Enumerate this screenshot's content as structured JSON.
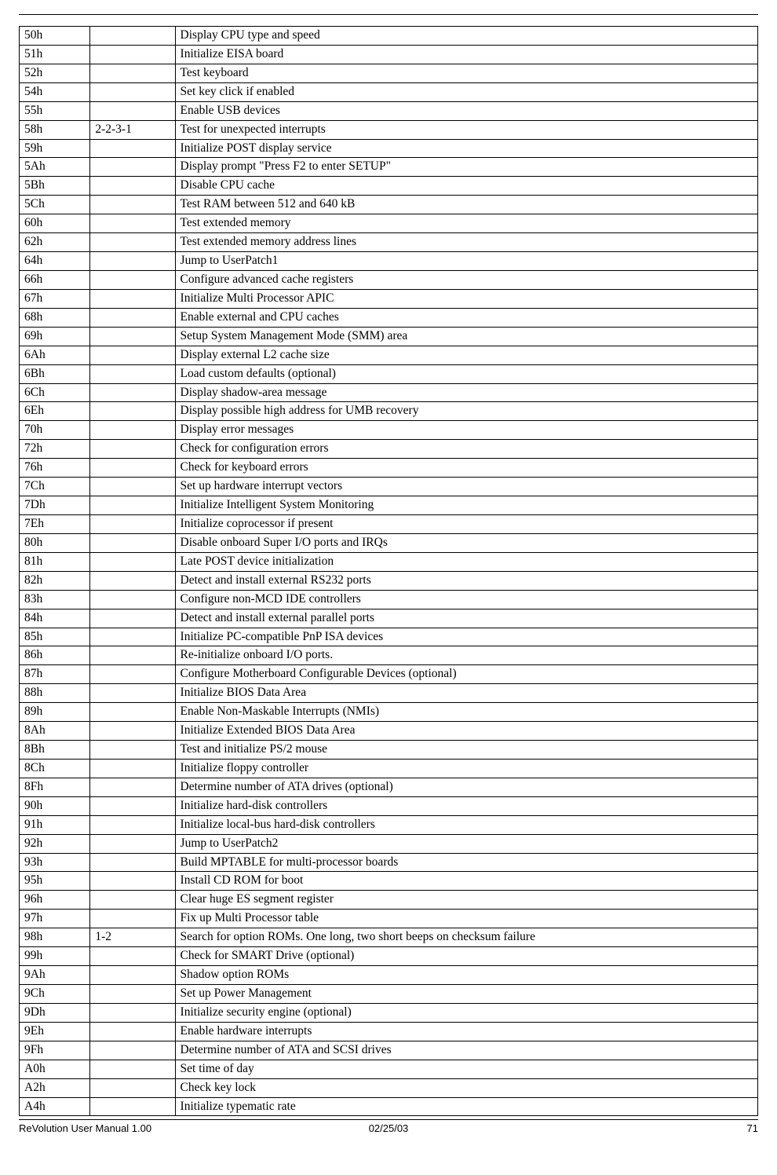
{
  "footer": {
    "left": "ReVolution User Manual 1.00",
    "center": "02/25/03",
    "right": "71"
  },
  "rows": [
    {
      "code": "50h",
      "beep": "",
      "desc": "Display CPU type and speed"
    },
    {
      "code": "51h",
      "beep": "",
      "desc": "Initialize EISA board"
    },
    {
      "code": "52h",
      "beep": "",
      "desc": "Test keyboard"
    },
    {
      "code": "54h",
      "beep": "",
      "desc": "Set key click if enabled"
    },
    {
      "code": "55h",
      "beep": "",
      "desc": "Enable USB devices"
    },
    {
      "code": "58h",
      "beep": "2-2-3-1",
      "desc": "Test for unexpected interrupts"
    },
    {
      "code": "59h",
      "beep": "",
      "desc": "Initialize POST display service"
    },
    {
      "code": "5Ah",
      "beep": "",
      "desc": "Display prompt \"Press F2 to enter SETUP\""
    },
    {
      "code": "5Bh",
      "beep": "",
      "desc": "Disable CPU cache"
    },
    {
      "code": "5Ch",
      "beep": "",
      "desc": "Test RAM between 512 and 640 kB"
    },
    {
      "code": "60h",
      "beep": "",
      "desc": "Test extended memory"
    },
    {
      "code": "62h",
      "beep": "",
      "desc": "Test extended memory address lines"
    },
    {
      "code": "64h",
      "beep": "",
      "desc": "Jump to UserPatch1"
    },
    {
      "code": "66h",
      "beep": "",
      "desc": "Configure advanced cache registers"
    },
    {
      "code": "67h",
      "beep": "",
      "desc": "Initialize Multi Processor APIC"
    },
    {
      "code": "68h",
      "beep": "",
      "desc": "Enable external and CPU caches"
    },
    {
      "code": "69h",
      "beep": "",
      "desc": "Setup System Management Mode (SMM) area"
    },
    {
      "code": "6Ah",
      "beep": "",
      "desc": "Display external L2 cache size"
    },
    {
      "code": "6Bh",
      "beep": "",
      "desc": "Load custom defaults (optional)"
    },
    {
      "code": "6Ch",
      "beep": "",
      "desc": "Display shadow-area message"
    },
    {
      "code": "6Eh",
      "beep": "",
      "desc": "Display possible high address for UMB recovery"
    },
    {
      "code": "70h",
      "beep": "",
      "desc": "Display error messages"
    },
    {
      "code": "72h",
      "beep": "",
      "desc": "Check for configuration errors"
    },
    {
      "code": "76h",
      "beep": "",
      "desc": "Check for keyboard errors"
    },
    {
      "code": "7Ch",
      "beep": "",
      "desc": "Set up hardware interrupt vectors"
    },
    {
      "code": "7Dh",
      "beep": "",
      "desc": "Initialize Intelligent System Monitoring"
    },
    {
      "code": "7Eh",
      "beep": "",
      "desc": "Initialize coprocessor if present"
    },
    {
      "code": "80h",
      "beep": "",
      "desc": "Disable onboard Super I/O ports and IRQs"
    },
    {
      "code": "81h",
      "beep": "",
      "desc": "Late POST device initialization"
    },
    {
      "code": "82h",
      "beep": "",
      "desc": "Detect and install external RS232 ports"
    },
    {
      "code": "83h",
      "beep": "",
      "desc": "Configure non-MCD IDE controllers"
    },
    {
      "code": "84h",
      "beep": "",
      "desc": "Detect and install external parallel ports"
    },
    {
      "code": "85h",
      "beep": "",
      "desc": "Initialize PC-compatible PnP ISA devices"
    },
    {
      "code": "86h",
      "beep": "",
      "desc": "Re-initialize onboard I/O ports."
    },
    {
      "code": "87h",
      "beep": "",
      "desc": "Configure Motherboard Configurable Devices (optional)"
    },
    {
      "code": "88h",
      "beep": "",
      "desc": "Initialize BIOS Data Area"
    },
    {
      "code": "89h",
      "beep": "",
      "desc": "Enable Non-Maskable Interrupts (NMIs)"
    },
    {
      "code": "8Ah",
      "beep": "",
      "desc": "Initialize Extended BIOS Data Area"
    },
    {
      "code": "8Bh",
      "beep": "",
      "desc": "Test and initialize PS/2 mouse"
    },
    {
      "code": "8Ch",
      "beep": "",
      "desc": "Initialize floppy controller"
    },
    {
      "code": "8Fh",
      "beep": "",
      "desc": "Determine number of ATA drives (optional)"
    },
    {
      "code": "90h",
      "beep": "",
      "desc": "Initialize hard-disk controllers"
    },
    {
      "code": "91h",
      "beep": "",
      "desc": "Initialize local-bus hard-disk controllers"
    },
    {
      "code": "92h",
      "beep": "",
      "desc": "Jump to UserPatch2"
    },
    {
      "code": "93h",
      "beep": "",
      "desc": "Build MPTABLE for multi-processor boards"
    },
    {
      "code": "95h",
      "beep": "",
      "desc": "Install CD ROM for boot"
    },
    {
      "code": "96h",
      "beep": "",
      "desc": "Clear huge ES segment register"
    },
    {
      "code": "97h",
      "beep": "",
      "desc": "Fix up Multi Processor table"
    },
    {
      "code": "98h",
      "beep": "1-2",
      "desc": "Search for option ROMs. One long, two short beeps on checksum failure"
    },
    {
      "code": "99h",
      "beep": "",
      "desc": "Check for SMART Drive (optional)"
    },
    {
      "code": "9Ah",
      "beep": "",
      "desc": "Shadow option ROMs"
    },
    {
      "code": "9Ch",
      "beep": "",
      "desc": "Set up Power Management"
    },
    {
      "code": "9Dh",
      "beep": "",
      "desc": "Initialize security engine (optional)"
    },
    {
      "code": "9Eh",
      "beep": "",
      "desc": "Enable hardware interrupts"
    },
    {
      "code": "9Fh",
      "beep": "",
      "desc": "Determine number of ATA and SCSI drives"
    },
    {
      "code": "A0h",
      "beep": "",
      "desc": "Set time of day"
    },
    {
      "code": "A2h",
      "beep": "",
      "desc": "Check key lock"
    },
    {
      "code": "A4h",
      "beep": "",
      "desc": "Initialize typematic rate"
    }
  ]
}
